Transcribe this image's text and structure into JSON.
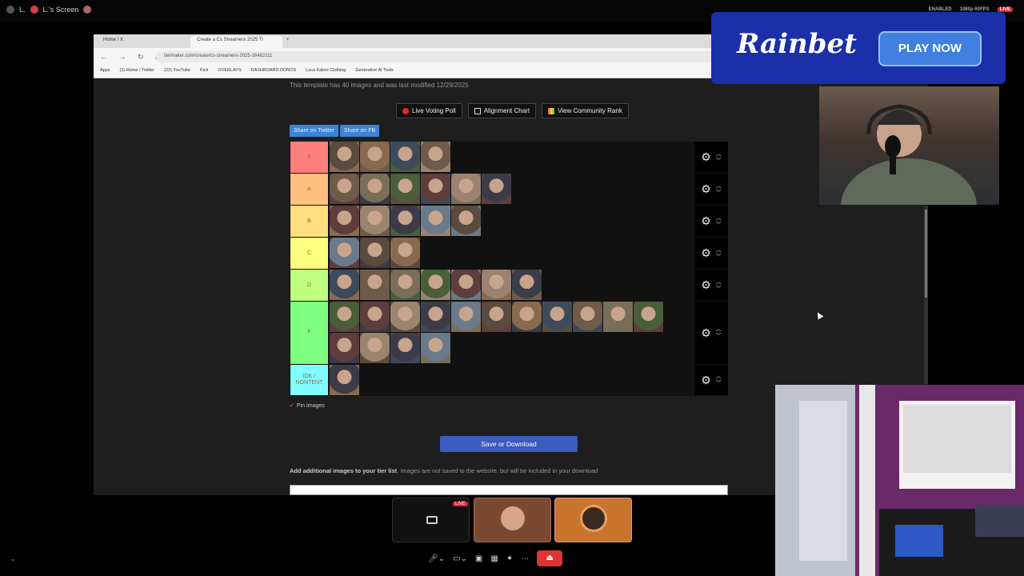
{
  "topbar": {
    "user": "L.",
    "screen_title": "L.'s Screen",
    "indicators": [
      "ENABLED",
      "1080p 60FPS"
    ],
    "live": "LIVE"
  },
  "browser": {
    "tabs": [
      {
        "label": "Home / X",
        "active": false
      },
      {
        "label": "Create a Cs Streamers 2025 Ti",
        "active": true
      }
    ],
    "url": "tiermaker.com/create/cs-streamers-2025-16482111",
    "bookmarks": [
      "Apps",
      "(1) Home / Twitter",
      "(23) YouTube",
      "Kick",
      "OVERLAYS",
      "DASHBOARD DONOS",
      "Luca Faloni Clothing",
      "Generative AI Tools"
    ]
  },
  "page": {
    "template_info": "This template has 40 images and was last modified 12/29/2025",
    "actions": [
      {
        "label": "Live Voting Poll",
        "icon": "red-dot-icon"
      },
      {
        "label": "Alignment Chart",
        "icon": "grid-icon"
      },
      {
        "label": "View Community Rank",
        "icon": "rank-icon"
      }
    ],
    "share": [
      "Share on Twitter",
      "Share on FB"
    ],
    "pin_images": "Pin Images",
    "save_label": "Save or Download",
    "add_images_bold": "Add additional images to your tier list",
    "add_images_rest": ". Images are not saved to the website, but will be included in your download",
    "chat_label": "L"
  },
  "tiers": [
    {
      "label": "S",
      "color": "#ff7f7f",
      "items": 4
    },
    {
      "label": "A",
      "color": "#ffbf7f",
      "items": 6
    },
    {
      "label": "B",
      "color": "#ffdf7f",
      "items": 5
    },
    {
      "label": "C",
      "color": "#ffff7f",
      "items": 3
    },
    {
      "label": "D",
      "color": "#bfff7f",
      "items": 7
    },
    {
      "label": "F",
      "color": "#7fff7f",
      "items": 15
    },
    {
      "label": "IDK / NONTENT",
      "color": "#7fffff",
      "items": 1
    }
  ],
  "ad": {
    "brand": "Rainbet",
    "cta": "PLAY NOW"
  },
  "call": {
    "live": "LIVE",
    "controls": [
      "mic-icon",
      "camera-icon",
      "share-screen-icon",
      "grid-icon",
      "effects-icon",
      "more-icon"
    ],
    "leave_icon": "leave-icon"
  }
}
